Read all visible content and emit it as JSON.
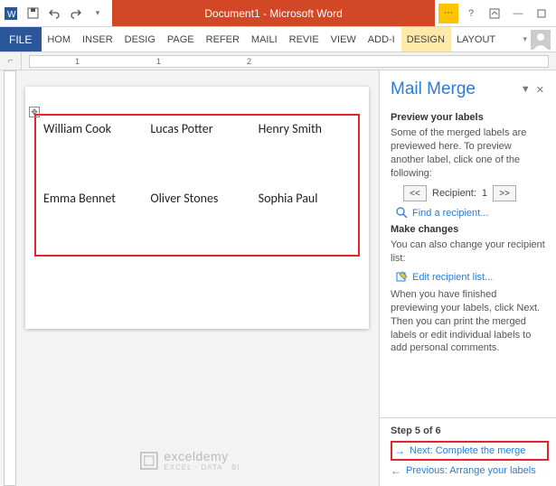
{
  "titlebar": {
    "title": "Document1 - Microsoft Word"
  },
  "ribbon": {
    "file": "FILE",
    "tabs": [
      "HOM",
      "INSER",
      "DESIG",
      "PAGE",
      "REFER",
      "MAILI",
      "REVIE",
      "VIEW",
      "ADD-I"
    ],
    "contextual": [
      "DESIGN",
      "LAYOUT"
    ]
  },
  "ruler": {
    "marks": [
      "1",
      "1",
      "2"
    ]
  },
  "labels": {
    "row1": [
      "William Cook",
      "Lucas Potter",
      "Henry Smith"
    ],
    "row2": [
      "Emma Bennet",
      "Oliver Stones",
      "Sophia Paul"
    ]
  },
  "watermark": {
    "brand": "exceldemy",
    "tag": "EXCEL · DATA · BI"
  },
  "pane": {
    "title": "Mail Merge",
    "preview_h": "Preview your labels",
    "preview_p": "Some of the merged labels are previewed here. To preview another label, click one of the following:",
    "recipient_label": "Recipient:",
    "recipient_num": "1",
    "find": "Find a recipient...",
    "changes_h": "Make changes",
    "changes_p": "You can also change your recipient list:",
    "edit": "Edit recipient list...",
    "finish_p": "When you have finished previewing your labels, click Next. Then you can print the merged labels or edit individual labels to add personal comments.",
    "step": "Step 5 of 6",
    "next": "Next: Complete the merge",
    "prev": "Previous: Arrange your labels"
  }
}
